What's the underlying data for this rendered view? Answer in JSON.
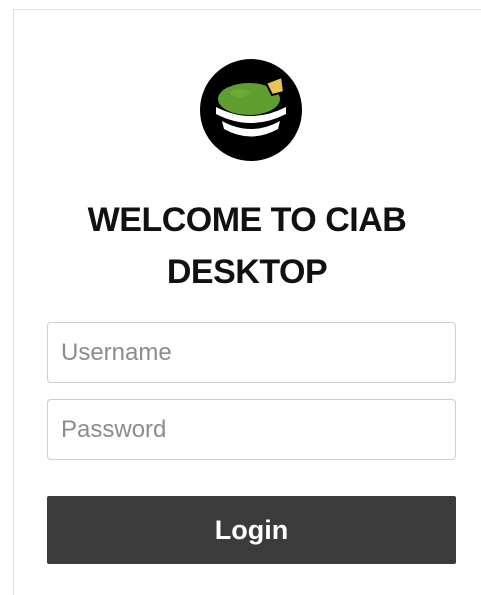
{
  "logo": {
    "icon": "guacamole-bowl-icon",
    "colors": {
      "outer": "#000000",
      "guac": "#5f9e2f",
      "chip": "#e8c35a"
    }
  },
  "header": {
    "title_line1": "WELCOME TO CIAB",
    "title_line2": "DESKTOP"
  },
  "form": {
    "username_placeholder": "Username",
    "password_placeholder": "Password",
    "login_label": "Login"
  }
}
